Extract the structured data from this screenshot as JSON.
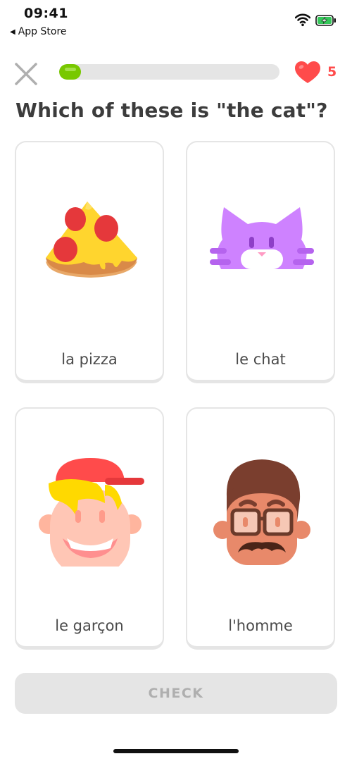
{
  "status_bar": {
    "time": "09:41",
    "back_app": "App Store",
    "back_arrow": "◀",
    "wifi_icon": "wifi-icon",
    "battery_icon": "battery-charging-icon"
  },
  "header": {
    "close_icon": "close-icon",
    "progress": 0.1,
    "progress_color": "#78c800",
    "hearts": "5",
    "heart_color": "#ff4b4b"
  },
  "question": "Which of these is \"the cat\"?",
  "choices": [
    {
      "label": "la pizza",
      "icon": "pizza-icon"
    },
    {
      "label": "le chat",
      "icon": "cat-icon"
    },
    {
      "label": "le garçon",
      "icon": "boy-icon"
    },
    {
      "label": "l'homme",
      "icon": "man-icon"
    }
  ],
  "check_button": {
    "label": "CHECK"
  }
}
